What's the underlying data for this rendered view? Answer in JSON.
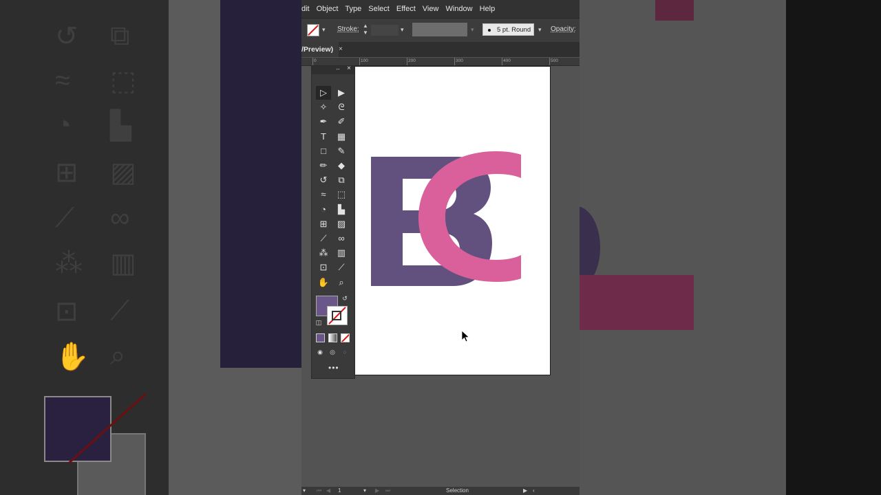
{
  "menu": [
    "dit",
    "Object",
    "Type",
    "Select",
    "Effect",
    "View",
    "Window",
    "Help"
  ],
  "control": {
    "stroke_label": "Stroke:",
    "brush_label": "5 pt. Round",
    "opacity_label": "Opacity:"
  },
  "document_tab": {
    "title": "/Preview)",
    "close_glyph": "×"
  },
  "ruler_ticks": [
    "0",
    "100",
    "200",
    "300",
    "400",
    "500"
  ],
  "tools": [
    {
      "name": "selection-tool-icon",
      "glyph": "▷"
    },
    {
      "name": "direct-selection-tool-icon",
      "glyph": "▶"
    },
    {
      "name": "magic-wand-tool-icon",
      "glyph": "✧"
    },
    {
      "name": "lasso-tool-icon",
      "glyph": "ᘓ"
    },
    {
      "name": "pen-tool-icon",
      "glyph": "✒"
    },
    {
      "name": "curvature-tool-icon",
      "glyph": "✐"
    },
    {
      "name": "type-tool-icon",
      "glyph": "T"
    },
    {
      "name": "grid-tool-icon",
      "glyph": "▦"
    },
    {
      "name": "rectangle-tool-icon",
      "glyph": "□"
    },
    {
      "name": "paintbrush-tool-icon",
      "glyph": "✎"
    },
    {
      "name": "pencil-tool-icon",
      "glyph": "✏"
    },
    {
      "name": "eraser-tool-icon",
      "glyph": "◆"
    },
    {
      "name": "rotate-tool-icon",
      "glyph": "↺"
    },
    {
      "name": "scale-tool-icon",
      "glyph": "⧉"
    },
    {
      "name": "warp-tool-icon",
      "glyph": "≈"
    },
    {
      "name": "free-transform-tool-icon",
      "glyph": "⬚"
    },
    {
      "name": "shape-builder-tool-icon",
      "glyph": "◔"
    },
    {
      "name": "perspective-grid-tool-icon",
      "glyph": "▙"
    },
    {
      "name": "mesh-tool-icon",
      "glyph": "⊞"
    },
    {
      "name": "gradient-tool-icon",
      "glyph": "▨"
    },
    {
      "name": "eyedropper-tool-icon",
      "glyph": "⟋"
    },
    {
      "name": "blend-tool-icon",
      "glyph": "∞"
    },
    {
      "name": "symbol-sprayer-tool-icon",
      "glyph": "⁂"
    },
    {
      "name": "column-graph-tool-icon",
      "glyph": "▥"
    },
    {
      "name": "artboard-tool-icon",
      "glyph": "⊡"
    },
    {
      "name": "slice-tool-icon",
      "glyph": "⟋"
    },
    {
      "name": "hand-tool-icon",
      "glyph": "✋"
    },
    {
      "name": "zoom-tool-icon",
      "glyph": "⌕"
    }
  ],
  "colors": {
    "fill": "#6a5689",
    "logo_b": "#62507f",
    "logo_c": "#d9609a"
  },
  "status": {
    "page": "1",
    "mode": "Selection"
  }
}
